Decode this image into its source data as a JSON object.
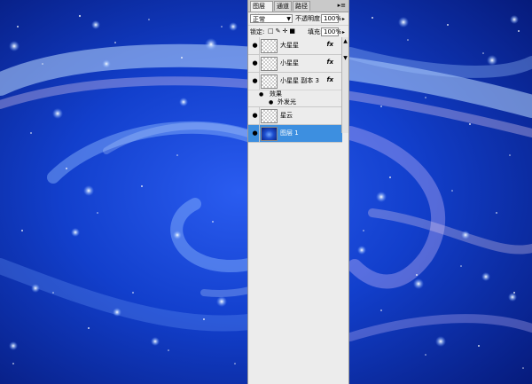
{
  "panel": {
    "tabs": [
      {
        "label": "图层",
        "close": "×"
      },
      {
        "label": "通道"
      },
      {
        "label": "路径"
      }
    ],
    "menu_icon": "panel-menu-icon",
    "blend_mode": "正常",
    "opacity_label": "不透明度:",
    "opacity_value": "100%",
    "lock_label": "锁定:",
    "fill_label": "填充:",
    "fill_value": "100%",
    "layers": [
      {
        "name": "大星星",
        "fx": "fx"
      },
      {
        "name": "小星星",
        "fx": "fx"
      },
      {
        "name": "小星星 副本 3",
        "fx": "fx"
      },
      {
        "name": "星云"
      },
      {
        "name": "图层 1"
      }
    ],
    "effects_label": "效果",
    "effect_item": "外发光"
  }
}
